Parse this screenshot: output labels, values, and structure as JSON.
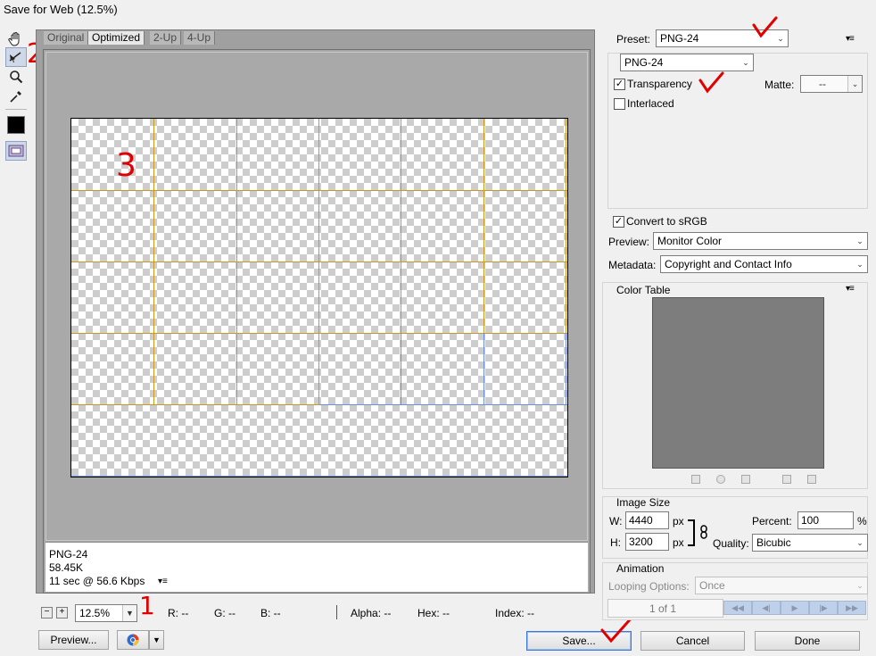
{
  "window": {
    "title": "Save for Web (12.5%)"
  },
  "tabs": [
    "Original",
    "Optimized",
    "2-Up",
    "4-Up"
  ],
  "image_info": {
    "format": "PNG-24",
    "size": "58.45K",
    "download_time": "11 sec @ 56.6 Kbps"
  },
  "status_bar": {
    "zoom": "12.5%",
    "r": "R: --",
    "g": "G: --",
    "b": "B: --",
    "alpha": "Alpha: --",
    "hex": "Hex: --",
    "index": "Index: --"
  },
  "buttons": {
    "preview": "Preview...",
    "save": "Save...",
    "cancel": "Cancel",
    "done": "Done"
  },
  "settings": {
    "preset_label": "Preset:",
    "preset_value": "PNG-24",
    "format_value": "PNG-24",
    "transparency_label": "Transparency",
    "transparency_checked": true,
    "interlaced_label": "Interlaced",
    "interlaced_checked": false,
    "matte_label": "Matte:",
    "matte_value": "--",
    "convert_srgb_label": "Convert to sRGB",
    "convert_srgb_checked": true,
    "preview_label": "Preview:",
    "preview_value": "Monitor Color",
    "metadata_label": "Metadata:",
    "metadata_value": "Copyright and Contact Info"
  },
  "color_table": {
    "title": "Color Table"
  },
  "image_size": {
    "title": "Image Size",
    "w_label": "W:",
    "w_value": "4440",
    "w_unit": "px",
    "h_label": "H:",
    "h_value": "3200",
    "h_unit": "px",
    "percent_label": "Percent:",
    "percent_value": "100",
    "percent_unit": "%",
    "quality_label": "Quality:",
    "quality_value": "Bicubic"
  },
  "animation": {
    "title": "Animation",
    "looping_label": "Looping Options:",
    "looping_value": "Once",
    "frame_counter": "1 of 1"
  },
  "annotations": [
    "1",
    "2",
    "3"
  ],
  "colors": {
    "slice_lines": "#c99a1e",
    "auto_slice_lines": "#6d8de0",
    "annotation": "#e00000",
    "color_table_bg": "#7d7d7d"
  },
  "icons": [
    "hand-icon",
    "slice-select-icon",
    "zoom-icon",
    "eyedropper-icon",
    "color-swatch-icon",
    "slice-visibility-icon",
    "browser-icon",
    "link-icon",
    "panel-menu-icon"
  ]
}
